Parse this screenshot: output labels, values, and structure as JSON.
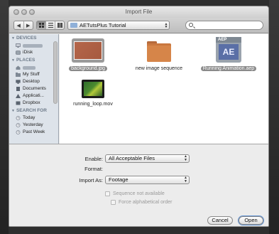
{
  "window": {
    "title": "Import File"
  },
  "toolbar": {
    "back": "◀",
    "forward": "▶",
    "view_icons": "icon-view-icon",
    "view_list": "list-view-icon",
    "view_columns": "column-view-icon",
    "path": "AETutsPlus Tutorial",
    "search_placeholder": ""
  },
  "sidebar": {
    "devices_header": "DEVICES",
    "devices": [
      {
        "label": "",
        "icon": "computer-icon",
        "redacted": true
      },
      {
        "label": "iDisk",
        "icon": "idisk-icon"
      }
    ],
    "places_header": "PLACES",
    "places": [
      {
        "label": "",
        "icon": "home-icon",
        "redacted": true
      },
      {
        "label": "My Stuff",
        "icon": "folder-icon"
      },
      {
        "label": "Desktop",
        "icon": "desktop-icon"
      },
      {
        "label": "Documents",
        "icon": "documents-icon"
      },
      {
        "label": "Applicati...",
        "icon": "applications-icon"
      },
      {
        "label": "Dropbox",
        "icon": "dropbox-icon"
      }
    ],
    "search_header": "SEARCH FOR",
    "searches": [
      {
        "label": "Today",
        "icon": "clock-icon"
      },
      {
        "label": "Yesterday",
        "icon": "clock-icon"
      },
      {
        "label": "Past Week",
        "icon": "clock-icon"
      }
    ]
  },
  "files": [
    {
      "name": "background.jpg",
      "selected": true,
      "kind": "image"
    },
    {
      "name": "new image sequence",
      "selected": false,
      "kind": "folder"
    },
    {
      "name": "Running Animation.aep",
      "selected": true,
      "kind": "aep",
      "badge": "AEP",
      "mark": "AE"
    },
    {
      "name": "running_loop.mov",
      "selected": false,
      "kind": "movie"
    }
  ],
  "options": {
    "enable_label": "Enable:",
    "enable_value": "All Acceptable Files",
    "format_label": "Format:",
    "import_as_label": "Import As:",
    "import_as_value": "Footage",
    "sequence_label": "Sequence not available",
    "force_alpha_label": "Force alphabetical order"
  },
  "buttons": {
    "cancel": "Cancel",
    "open": "Open"
  },
  "colors": {
    "accent": "#5d8fd0",
    "selection": "#8a8a8a",
    "sidebar_bg": "#dde3ea"
  }
}
